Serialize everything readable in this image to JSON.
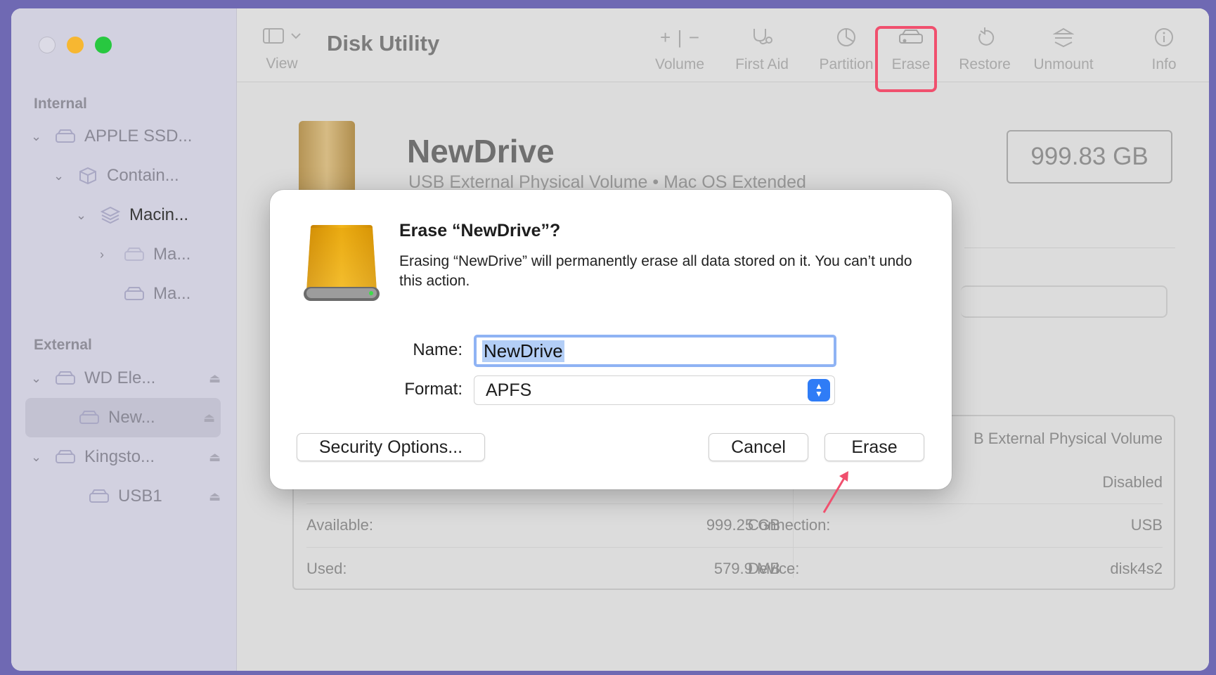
{
  "window": {
    "title": "Disk Utility"
  },
  "sidebar": {
    "internal_label": "Internal",
    "external_label": "External",
    "items": [
      {
        "label": "APPLE SSD..."
      },
      {
        "label": "Contain..."
      },
      {
        "label": "Macin..."
      },
      {
        "label": "Ma..."
      },
      {
        "label": "Ma..."
      },
      {
        "label": "WD Ele..."
      },
      {
        "label": "New..."
      },
      {
        "label": "Kingsto..."
      },
      {
        "label": "USB1"
      }
    ]
  },
  "toolbar": {
    "view_label": "View",
    "volume_label": "Volume",
    "first_aid_label": "First Aid",
    "partition_label": "Partition",
    "erase_label": "Erase",
    "restore_label": "Restore",
    "unmount_label": "Unmount",
    "info_label": "Info",
    "highlight_color": "#f0506e"
  },
  "volume": {
    "name": "NewDrive",
    "subtitle": "USB External Physical Volume • Mac OS Extended",
    "capacity": "999.83 GB",
    "details": {
      "type_value_partial": "B External Physical Volume",
      "owners_value": "Disabled",
      "available_label": "Available:",
      "available_value": "999.25 GB",
      "used_label": "Used:",
      "used_value": "579.9 MB",
      "connection_label": "Connection:",
      "connection_value": "USB",
      "device_label": "Device:",
      "device_value": "disk4s2"
    }
  },
  "dialog": {
    "title": "Erase “NewDrive”?",
    "message": "Erasing “NewDrive” will permanently erase all data stored on it. You can’t undo this action.",
    "name_label": "Name:",
    "name_value": "NewDrive",
    "format_label": "Format:",
    "format_value": "APFS",
    "security_button": "Security Options...",
    "cancel_button": "Cancel",
    "erase_button": "Erase"
  },
  "colors": {
    "accent": "#2f7cf6",
    "annotation": "#f0506e"
  }
}
